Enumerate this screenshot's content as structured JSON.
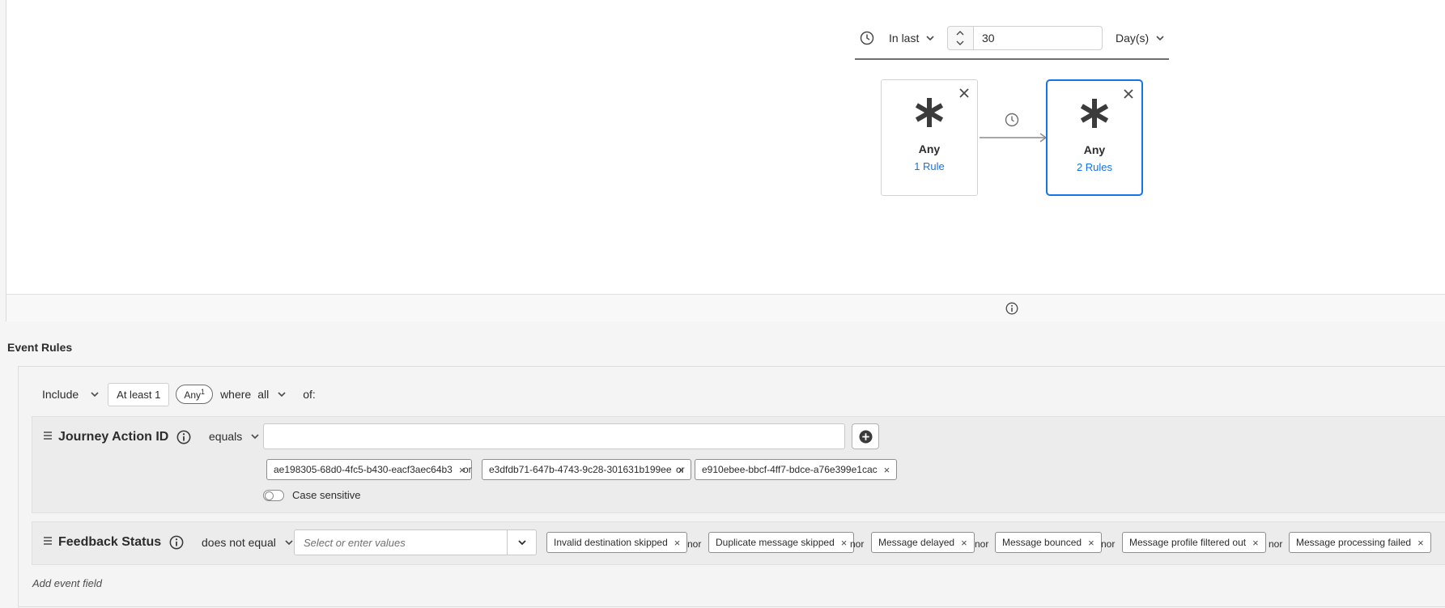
{
  "time_window": {
    "mode_label": "In last",
    "value": "30",
    "unit_label": "Day(s)"
  },
  "sequence": {
    "cards": [
      {
        "title": "Any",
        "rules_link": "1 Rule",
        "selected": false
      },
      {
        "title": "Any",
        "rules_link": "2 Rules",
        "selected": true
      }
    ]
  },
  "event_rules": {
    "section_title": "Event Rules",
    "include_label": "Include",
    "at_least_label": "At least 1",
    "any_badge_label": "Any",
    "any_badge_count": "1",
    "where_label": "where",
    "all_label": "all",
    "of_label": "of:",
    "fields": [
      {
        "name": "Journey Action ID",
        "operator": "equals",
        "input_value": "",
        "tags": [
          "ae198305-68d0-4fc5-b430-eacf3aec64b3",
          "e3dfdb71-647b-4743-9c28-301631b199ee",
          "e910ebee-bbcf-4ff7-bdce-a76e399e1cac"
        ],
        "connector": "or",
        "case_sensitive_label": "Case sensitive",
        "case_sensitive": false
      },
      {
        "name": "Feedback Status",
        "operator": "does not equal",
        "input_placeholder": "Select or enter values",
        "tags": [
          "Invalid destination skipped",
          "Duplicate message skipped",
          "Message delayed",
          "Message bounced",
          "Message profile filtered out",
          "Message processing failed"
        ],
        "connector": "nor"
      }
    ],
    "add_event_field_label": "Add event field"
  },
  "colors": {
    "accent": "#1473e6",
    "text": "#2c2c2c",
    "panel": "#f4f4f4"
  }
}
